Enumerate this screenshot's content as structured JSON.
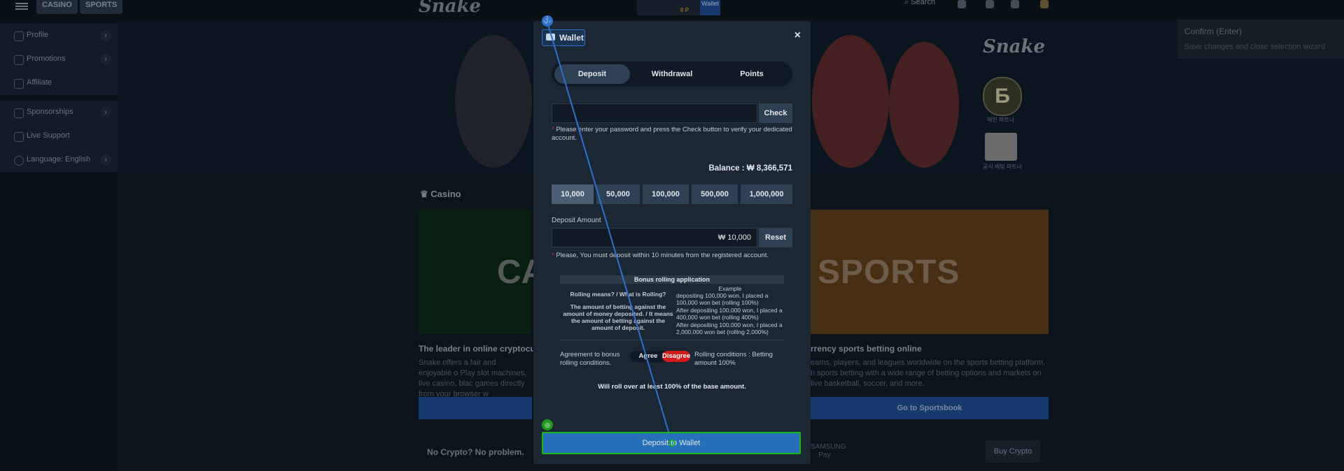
{
  "topbar": {
    "casino_label": "CASINO",
    "sports_label": "SPORTS",
    "logo": "Snake",
    "card_text": "0 P",
    "wallet_label": "Wallet",
    "search_label": "Search"
  },
  "sidebar": {
    "items": [
      {
        "label": "Profile"
      },
      {
        "label": "Promotions"
      },
      {
        "label": "Affiliate"
      },
      {
        "label": "Sponsorships"
      },
      {
        "label": "Live Support"
      },
      {
        "label": "Language: English"
      }
    ]
  },
  "hero": {
    "brand": "Snake",
    "badge_letter": "Б",
    "badge_caption": "메인 파트너",
    "badge2_caption": "공식 배팅 파트너"
  },
  "confirm_tooltip": {
    "title": "Confirm (Enter)",
    "subtitle": "Save changes and close selection wizard"
  },
  "main": {
    "section_title": "Casino",
    "casino_card_text": "CA",
    "sports_card_text": "SPORTS",
    "left_heading": "The leader in online cryptocur",
    "left_text": "Snake offers a fair and enjoyable o Play slot machines, live casino, blac games directly from your browser w",
    "right_heading": "rrency sports betting online",
    "right_text": "eams, players, and leagues worldwide on the sports betting platform. n sports betting with a wide range of betting options and markets on live basketball, soccer, and more.",
    "sportsbook_button": "Go to Sportsbook",
    "no_crypto": "No Crypto? No problem.",
    "samsung_pay": "SAMSUNG Pay",
    "buy_crypto": "Buy Crypto"
  },
  "modal": {
    "title": "Wallet",
    "close_icon": "×",
    "tabs": [
      "Deposit",
      "Withdrawal",
      "Points"
    ],
    "active_tab": "Deposit",
    "password_value": "",
    "check_button": "Check",
    "password_note": "Please enter your password and press the Check button to verify your dedicated account.",
    "balance_label": "Balance : ₩ 8,366,571",
    "amounts": [
      "10,000",
      "50,000",
      "100,000",
      "500,000",
      "1,000,000"
    ],
    "selected_amount": "10,000",
    "deposit_label": "Deposit Amount",
    "deposit_value": "₩ 10,000",
    "reset_button": "Reset",
    "deposit_note": "Please, You must deposit within 10 minutes from the registered account.",
    "bonus_title": "Bonus rolling application",
    "rolling_question": "Rolling means? / What is Rolling?",
    "rolling_definition": "The amount of betting against the amount of money deposited. / It means the amount of betting against the amount of deposit.",
    "example_title": "Example",
    "example_1": "depositing 100,000 won, I placed a 100,000 won bet (rolling 100%)",
    "example_2": "After depositing 100,000 won, I placed a 400,000 won bet (rolling 400%)",
    "example_3": "After depositing 100,000 won, I placed a 2,000,000 won bet (rolling 2,000%)",
    "agreement_label": "Agreement to bonus rolling conditions.",
    "agree": "Agree",
    "disagree": "Disagree",
    "rolling_conditions": "Rolling conditions : Betting amount 100%",
    "rollover_note": "Will roll over at least 100% of the base amount.",
    "deposit_button": "Deposit to Wallet"
  },
  "colors": {
    "accent_blue": "#2570b8",
    "disagree_red": "#d41a1a",
    "target_green": "#1cb51c"
  }
}
